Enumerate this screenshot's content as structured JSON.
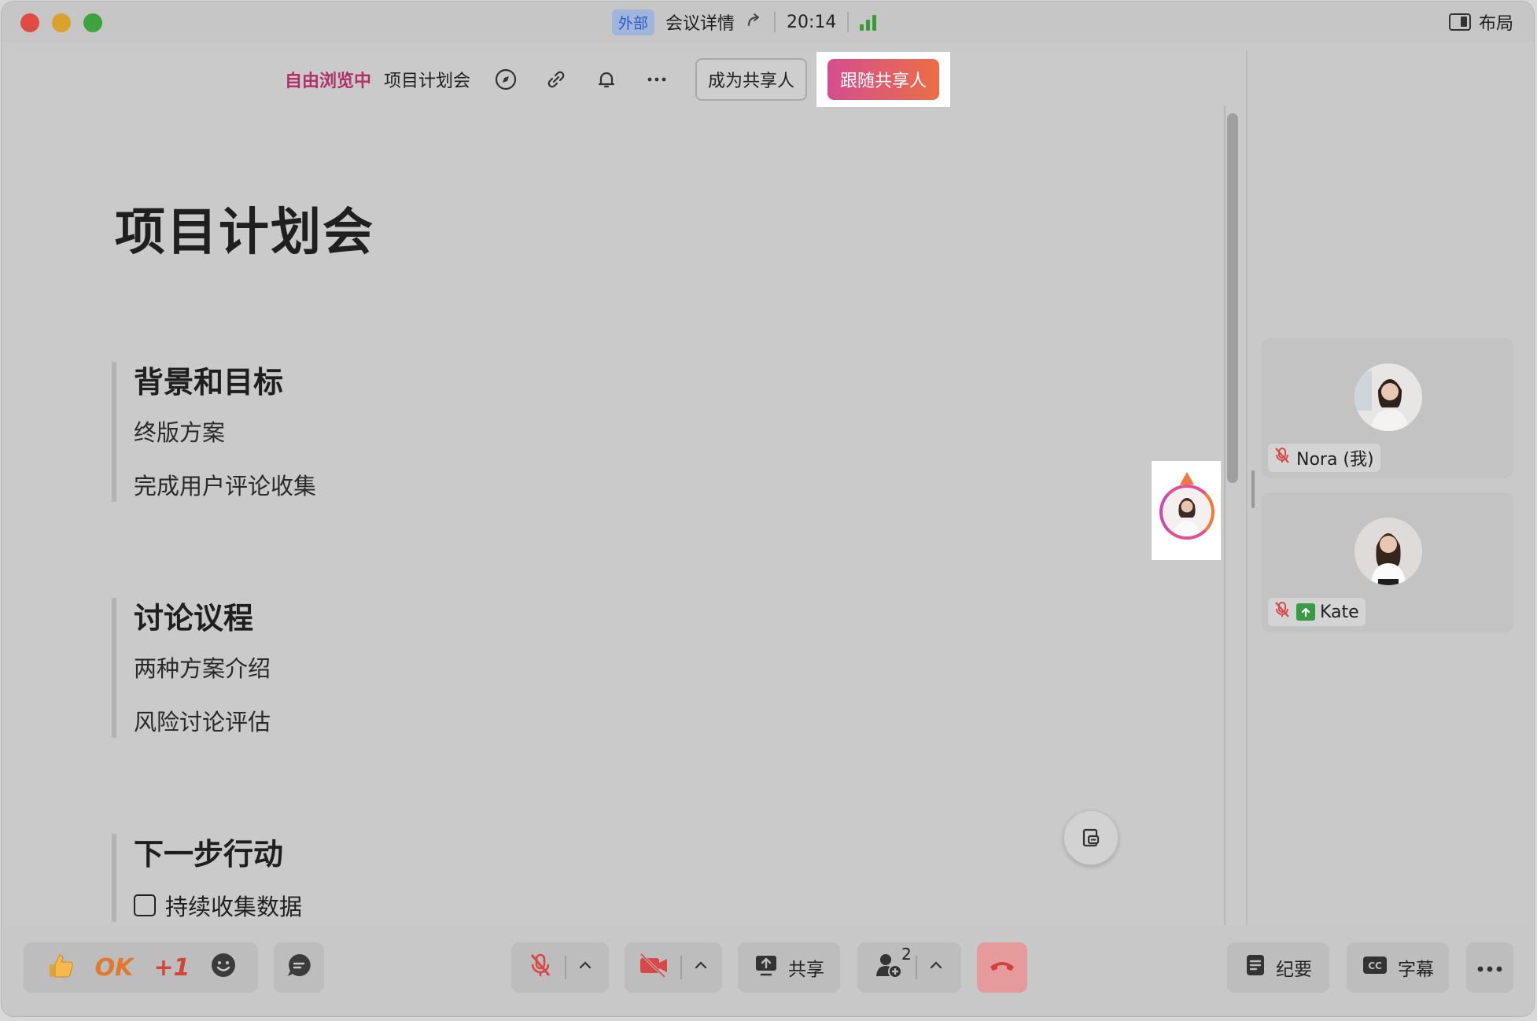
{
  "titlebar": {
    "badge": "外部",
    "meeting_details": "会议详情",
    "time": "20:14",
    "layout_label": "布局"
  },
  "doc_toolbar": {
    "status": "自由浏览中",
    "doc_name": "项目计划会",
    "become_sharer": "成为共享人",
    "follow_sharer": "跟随共享人"
  },
  "document": {
    "title": "项目计划会",
    "sections": [
      {
        "heading": "背景和目标",
        "items": [
          "终版方案",
          "完成用户评论收集"
        ]
      },
      {
        "heading": "讨论议程",
        "items": [
          "两种方案介绍",
          "风险讨论评估"
        ]
      },
      {
        "heading": "下一步行动",
        "checklist": [
          {
            "label": "持续收集数据",
            "checked": false
          }
        ]
      }
    ]
  },
  "participants": [
    {
      "name": "Nora (我)",
      "muted": true,
      "sharing": false
    },
    {
      "name": "Kate",
      "muted": true,
      "sharing": true
    }
  ],
  "bottom_bar": {
    "reactions": [
      "thumbs-up",
      "OK",
      "+1",
      "emoji"
    ],
    "ok_label": "OK",
    "plus_one_label": "+1",
    "share_label": "共享",
    "participant_count": "2",
    "minutes_label": "纪要",
    "captions_label": "字幕"
  },
  "colors": {
    "free_browse": "#b0306a",
    "follow_gradient_start": "#d44d90",
    "follow_gradient_end": "#ec6e45",
    "signal_green": "#3d9a3a",
    "mute_red": "#d94848"
  }
}
